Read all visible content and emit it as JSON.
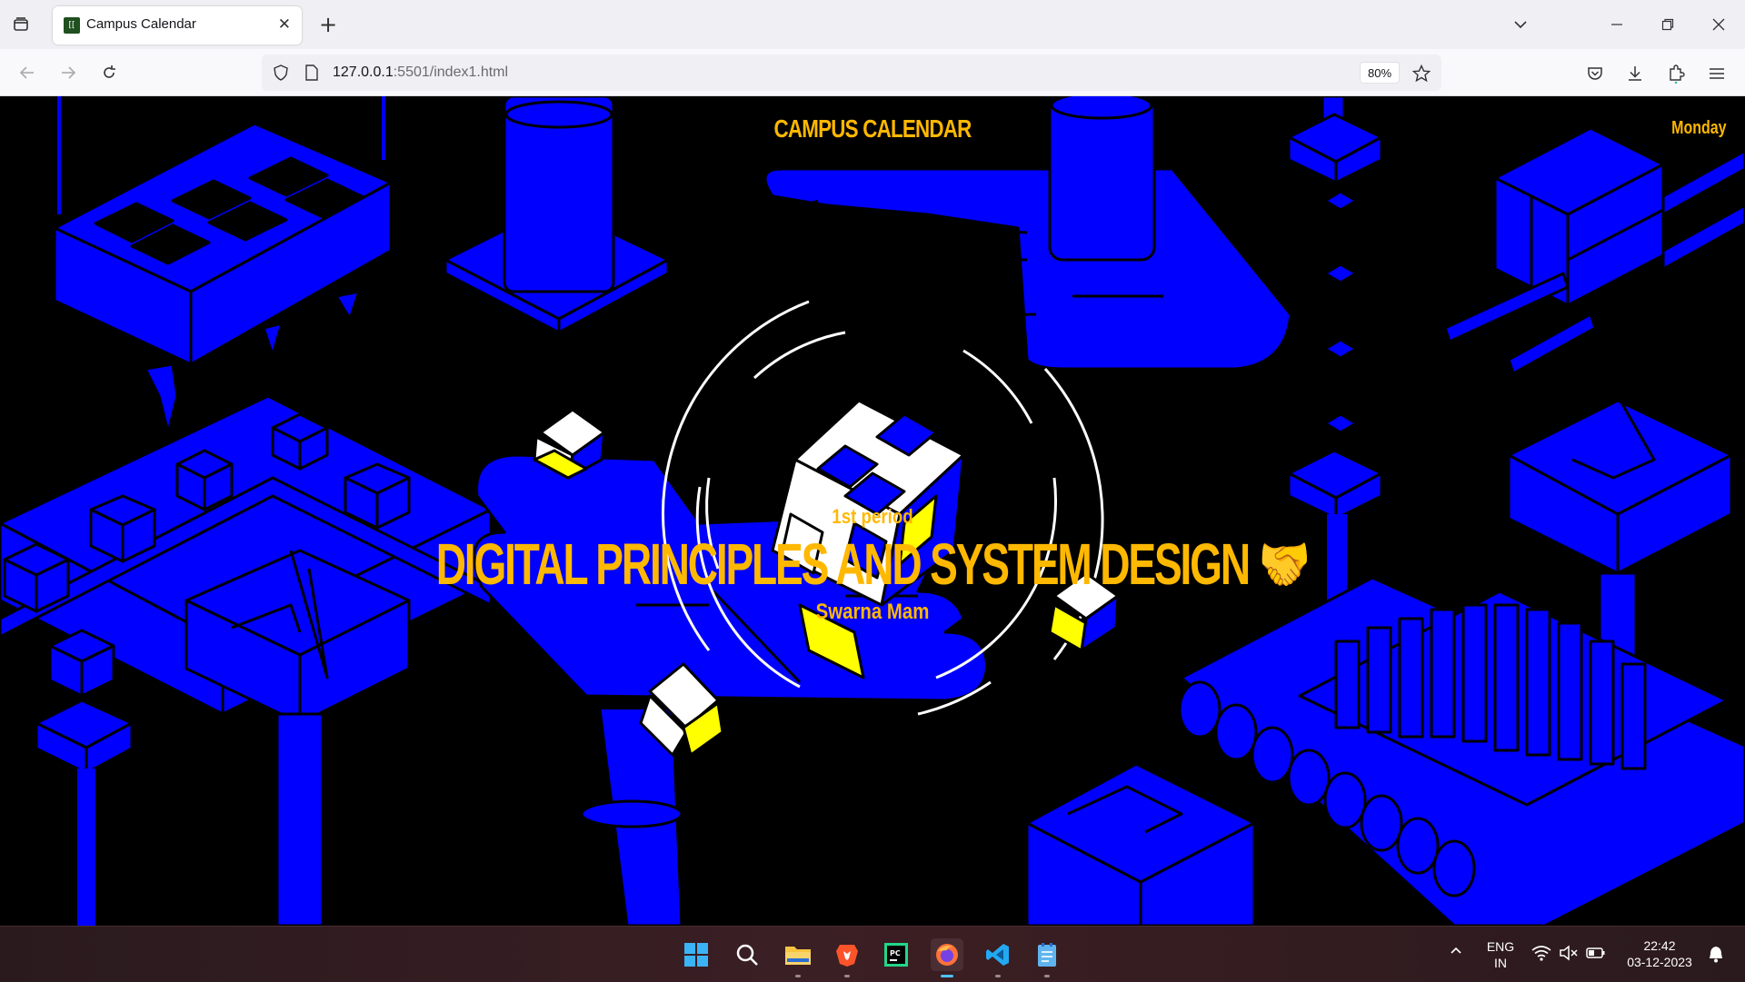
{
  "browser": {
    "tab_title": "Campus Calendar",
    "tab_favicon": "campus-calendar-favicon",
    "url_host": "127.0.0.1",
    "url_rest": ":5501/index1.html",
    "zoom": "80%"
  },
  "page": {
    "brand": "CAMPUS CALENDAR",
    "day": "Monday",
    "period": "1st period",
    "subject": "DIGITAL PRINCIPLES AND SYSTEM DESIGN 🤝",
    "teacher": "Swarna Mam"
  },
  "colors": {
    "background": "#000000",
    "illustration_blue": "#0000ff",
    "accent_yellow": "#ffb800",
    "cube_yellow": "#ffff00"
  },
  "taskbar": {
    "apps": [
      "windows-start-icon",
      "search-icon",
      "file-explorer-icon",
      "brave-browser-icon",
      "pycharm-icon",
      "firefox-icon",
      "vscode-icon",
      "notepad-icon"
    ],
    "language_line1": "ENG",
    "language_line2": "IN",
    "time": "22:42",
    "date": "03-12-2023"
  }
}
